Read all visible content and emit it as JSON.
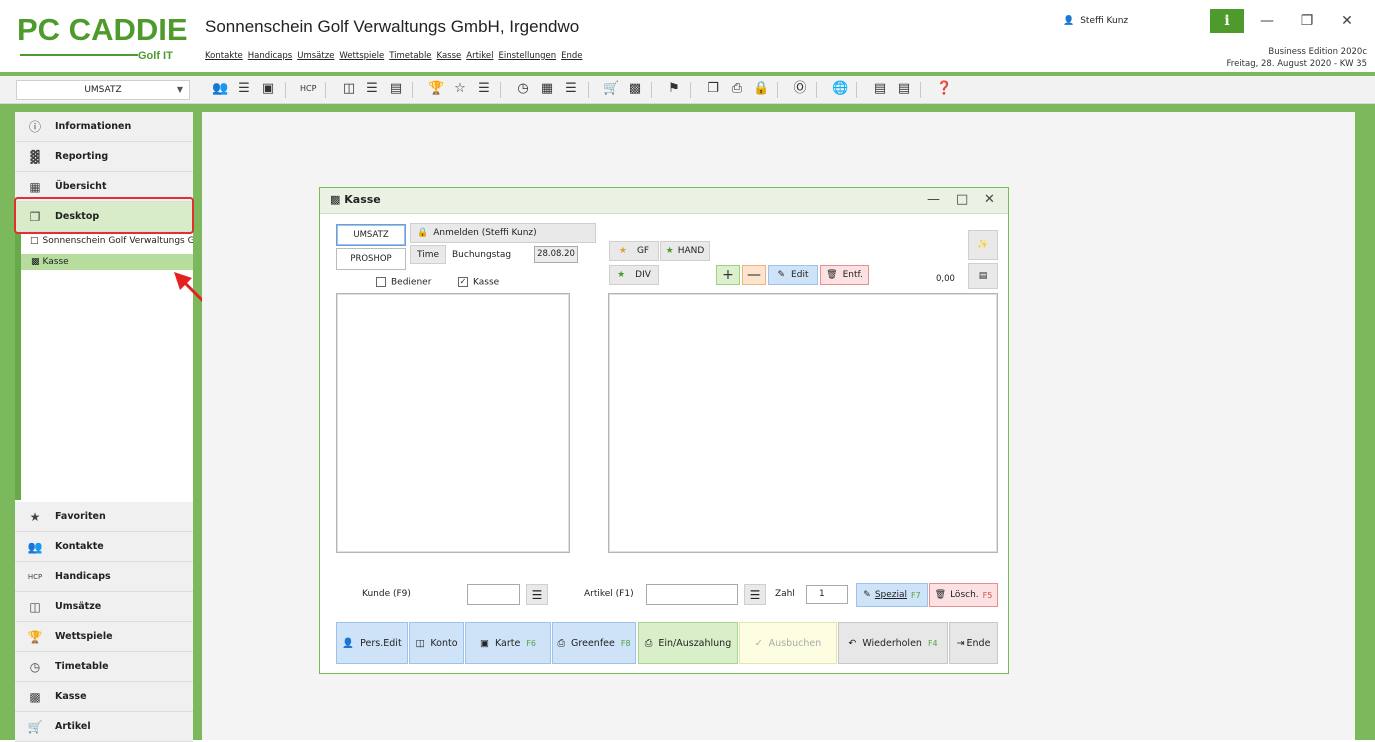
{
  "app": {
    "logo_main": "PC CADDIE",
    "logo_sub": "Golf IT",
    "title": "Sonnenschein Golf Verwaltungs GmbH, Irgendwo",
    "menu": [
      "Kontakte",
      "Handicaps",
      "Umsätze",
      "Wettspiele",
      "Timetable",
      "Kasse",
      "Artikel",
      "Einstellungen",
      "Ende"
    ],
    "user": "Steffi Kunz",
    "info_label": "i",
    "edition": "Business Edition 2020c",
    "date": "Freitag, 28. August 2020 - KW 35"
  },
  "toolbar": {
    "select_value": "UMSATZ"
  },
  "sidebar": {
    "items": [
      "Informationen",
      "Reporting",
      "Übersicht",
      "Desktop"
    ],
    "tree": [
      "Sonnenschein Golf Verwaltungs Gmb",
      "Kasse"
    ],
    "bottom": [
      "Favoriten",
      "Kontakte",
      "Handicaps",
      "Umsätze",
      "Wettspiele",
      "Timetable",
      "Kasse",
      "Artikel"
    ]
  },
  "kasse": {
    "title": "Kasse",
    "tab_umsatz": "UMSATZ",
    "tab_proshop": "PROSHOP",
    "anmelden": "Anmelden (Steffi Kunz)",
    "time": "Time",
    "buchungstag": "Buchungstag",
    "date": "28.08.20",
    "bediener": "Bediener",
    "kasse_cb": "Kasse",
    "gf": "GF",
    "hand": "HAND",
    "div": "DIV",
    "edit": "Edit",
    "entf": "Entf.",
    "total": "0,00",
    "kunde": "Kunde (F9)",
    "artikel": "Artikel (F1)",
    "zahl": "Zahl",
    "zahl_value": "1",
    "spezial": "Spezial",
    "spezial_key": "F7",
    "loesch": "Lösch.",
    "loesch_key": "F5",
    "pers_edit": "Pers.Edit",
    "konto": "Konto",
    "karte": "Karte",
    "karte_key": "F6",
    "greenfee": "Greenfee",
    "greenfee_key": "F8",
    "einaus": "Ein/Auszahlung",
    "ausbuchen": "Ausbuchen",
    "wiederholen": "Wiederholen",
    "wiederholen_key": "F4",
    "ende": "Ende"
  },
  "colors": {
    "brand": "#4e9a2c",
    "frame": "#7cb85c",
    "highlight": "#e03030"
  }
}
